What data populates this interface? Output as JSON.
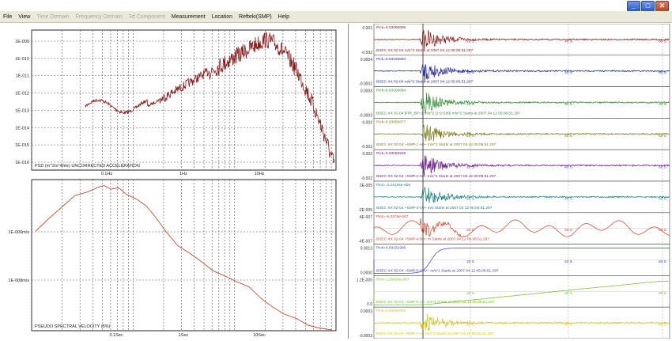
{
  "menu": [
    {
      "label": "File",
      "enabled": true
    },
    {
      "label": "View",
      "enabled": true
    },
    {
      "label": "Time Domain",
      "enabled": false
    },
    {
      "label": "Frequency Domain",
      "enabled": false
    },
    {
      "label": "3d Component",
      "enabled": false
    },
    {
      "label": "Measurement",
      "enabled": true
    },
    {
      "label": "Location",
      "enabled": true
    },
    {
      "label": "Refteki(SMP)",
      "enabled": true
    },
    {
      "label": "Help",
      "enabled": true
    }
  ],
  "window_buttons": {
    "minimize": "_",
    "maximize": "□",
    "close": "✕"
  },
  "colors": {
    "psd_trace": "#8b1a1a",
    "sv_trace": "#c0391b",
    "grid": "#555555",
    "menubar": "#ece9d8"
  },
  "psd_plot": {
    "title": "PSD (m^2/s^4/Hz) UNCORRECTED ACCELERATION",
    "y_tick_labels": [
      "1E-009",
      "1E-010",
      "1E-011",
      "1E-012",
      "1E-013",
      "1E-014",
      "1E-015",
      "1E-016"
    ],
    "x_tick_labels": [
      "0.1Hz",
      "1Hz",
      "10Hz"
    ]
  },
  "sv_plot": {
    "title": "PSEUDO SPECTRAL VELOCITY (5%)",
    "y_tick_labels": [
      "1E-006m/s",
      "1E-008m/s"
    ],
    "x_tick_labels": [
      "0.1Sec",
      "1Sec",
      "10Sec"
    ]
  },
  "traces": [
    {
      "pick": "Pick=0.03056895",
      "station": "BSEC XX 02-04  m/s^2  Starts at 2007.04.12 05:06:51.297",
      "ytop": "0.001",
      "ybottom": "-0.002",
      "color": "#8b1a1a",
      "type": "quake"
    },
    {
      "pick": "Pick=0.03100894",
      "station": "BSEC XX 02-04  m/s^2  Starts at 2007.04.12 05:06:51.297",
      "ytop": "0.0004",
      "ybottom": "-0.0002",
      "color": "#1f1f9e",
      "type": "quake"
    },
    {
      "pick": "Pick=0.03100894",
      "station": "BSEC XX 02-04  [FIR_BP=1 m/s^2 [1*2*200]  m/s^2 Starts at 2007.04.12 05:06:51.297",
      "ytop": "0.0003",
      "ybottom": "-0.0003",
      "color": "#2e8b2e",
      "type": "quake"
    },
    {
      "pick": "Pick=0.03056877",
      "station": "BSEC XX 02-04  ~SMP-1-A0~  m/s^2  Starts at 2007.04.12 05:06:51.297",
      "ytop": "0.002",
      "ybottom": "-0.003",
      "color": "#7a7a12",
      "type": "quake"
    },
    {
      "pick": "Pick=0.03056929",
      "station": "BSEC XX 02-04  ~SMP-2-A0~  m/s^2  Starts at 2007.04.12 05:06:51.297",
      "ytop": "0.002",
      "ybottom": "-0.002",
      "color": "#6a1f8a",
      "type": "quake"
    },
    {
      "pick": "Pick=-3.24194e-006",
      "station": "BSEC XX 02-04  ~SMP-3-V0~  m/s  Starts at 2007.04.12 05:06:51.297",
      "ytop": "2E-005",
      "ybottom": "-2E-005",
      "color": "#1a7f7f",
      "type": "quake"
    },
    {
      "pick": "Pick=-6.3276e-007",
      "station": "BSEC XX 02-04  ~SMP-4-D0~  m  Starts at 2007.04.12 05:06:51.297",
      "ytop": "4E-007",
      "ybottom": "-4E-007",
      "color": "#d23a1f",
      "type": "drift"
    },
    {
      "pick": "Pick=0.03151906",
      "station": "BSEC XX 02-04  ~SMP-5-CAV~  m/s*1  Starts at 2007.04.12 05:06:51.297",
      "ytop": "0.0013",
      "ybottom": "0.0000",
      "color": "#3a3ab0",
      "type": "step"
    },
    {
      "pick": "Pick=1.25826e-007",
      "station": "BSEC XX 02-04  ~SMP-6-AI~  m/s*1  Starts at 2007.04.12 05:06:51.297",
      "ytop": "1.2E-005",
      "ybottom": "0.0",
      "color": "#6fbf2a",
      "type": "ramp"
    },
    {
      "pick": "Pick=0.03056908",
      "station": "BSEC XX 02-04  ~SMP-7-A~  m/s^2  Starts at 2007.04.12 05:06:51.297",
      "ytop": "0.0003",
      "ybottom": "-0.0003",
      "color": "#d6c21a",
      "type": "quake"
    }
  ],
  "time_labels": [
    "20 S",
    "40 S",
    "60 S"
  ]
}
